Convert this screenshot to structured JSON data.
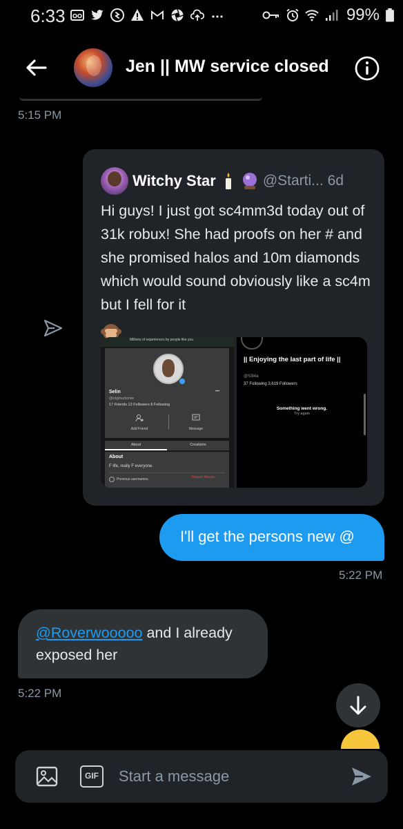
{
  "status_bar": {
    "time": "6:33",
    "battery": "99%",
    "left_icons": [
      "voicemail-icon",
      "twitter-bird-icon",
      "shazam-icon",
      "alert-triangle-icon",
      "gmail-icon",
      "aperture-icon",
      "cloud-upload-icon",
      "more-dots-icon"
    ],
    "right_icons": [
      "key-icon",
      "alarm-icon",
      "wifi-icon",
      "signal-icon",
      "battery-icon"
    ]
  },
  "header": {
    "title": "Jen || MW service closed",
    "back_icon": "arrow-left-icon",
    "info_icon": "info-icon"
  },
  "messages": {
    "first_timestamp": "5:15 PM",
    "quoted_tweet": {
      "author_name": "Witchy Star",
      "name_emojis": [
        "candle-emoji",
        "crystal-ball-emoji"
      ],
      "handle": "@Starti...",
      "age": "6d",
      "text": "Hi guys! I just got sc4mm3d today out of 31k robux! She had proofs on her # and she promised halos and 10m diamonds which would sound obviously like a sc4m but I fell for it",
      "trailing_emoji": "see-no-evil-monkey-emoji",
      "media_left": {
        "top_text": "Millions of experiences by people like you",
        "profile_name": "Selin",
        "profile_username": "@istgimurhomie",
        "stats": "17 Friends   12 Followers   8 Following",
        "add_friend": "Add Friend",
        "message": "Message",
        "tab_about": "About",
        "tab_creations": "Creations",
        "about_title": "About",
        "about_text": "F life, really F everyone.",
        "previous_usernames": "Previous usernames",
        "report_abuse": "Report Abuse"
      },
      "media_right": {
        "title": "|| Enjoying the last part of life ||",
        "handle": "@S3l4a",
        "stats": "37 Following   3,619 Followers",
        "error": "Something went wrong.",
        "retry": "Try again"
      }
    },
    "sent_bubble": "I'll get the persons new @",
    "sent_timestamp": "5:22 PM",
    "received_mention": "@Roverwooooo",
    "received_text": " and I already exposed her",
    "received_timestamp": "5:22 PM"
  },
  "composer": {
    "placeholder": "Start a message",
    "gif_label": "GIF",
    "image_icon": "image-icon",
    "send_icon": "send-icon"
  },
  "colors": {
    "background": "#000000",
    "accent": "#1d9bf0",
    "bubble_received": "#2f3336",
    "card": "#202327",
    "muted_text": "#8b98a5"
  }
}
